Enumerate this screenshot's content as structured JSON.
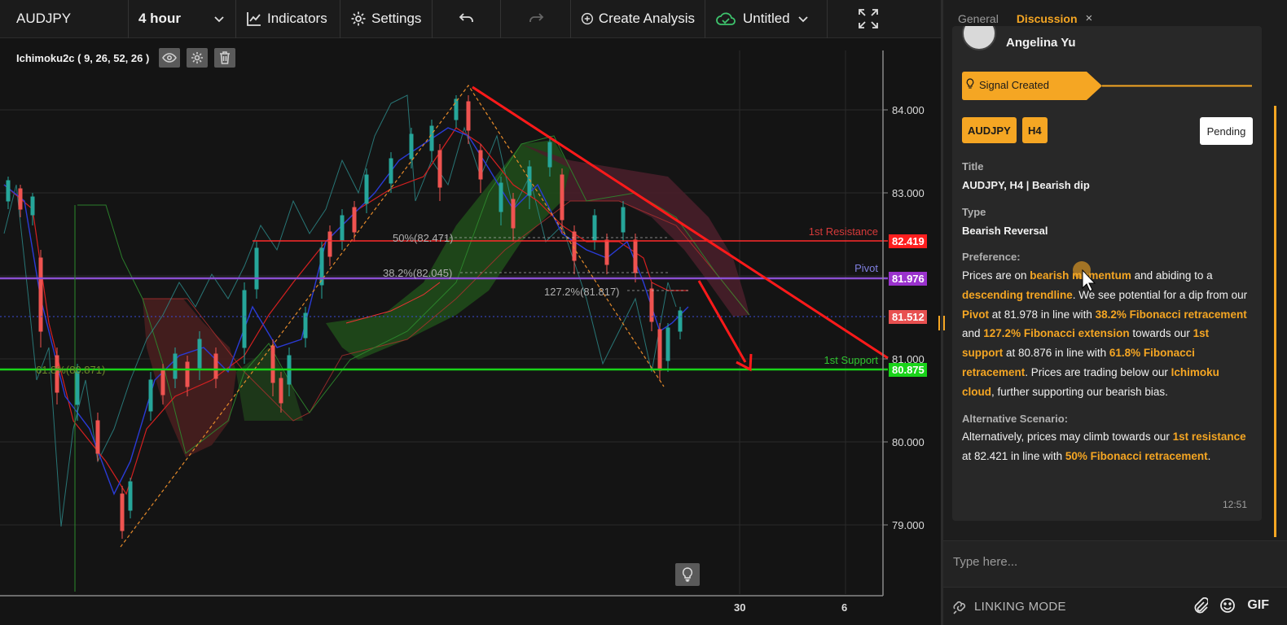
{
  "toolbar": {
    "symbol": "AUDJPY",
    "interval": "4 hour",
    "indicators_label": "Indicators",
    "settings_label": "Settings",
    "create_label": "Create Analysis",
    "layout_name": "Untitled"
  },
  "chart": {
    "indicator_label": "Ichimoku2c ( 9, 26, 52, 26 )",
    "price_axis": [
      "84.000",
      "83.000",
      "81.000",
      "80.000",
      "79.000"
    ],
    "time_axis": [
      "30",
      "6"
    ],
    "levels": {
      "resistance_label": "1st Resistance",
      "resistance_price": "82.419",
      "pivot_label": "Pivot",
      "pivot_price": "81.976",
      "current_price": "81.512",
      "support_label": "1st Support",
      "support_price": "80.875"
    },
    "fib_labels": {
      "fib50": "50%(82.471)",
      "fib382": "38.2%(82.045)",
      "fib1272": "127.2%(81.817)",
      "fib618": "61.8%(80.871)"
    },
    "colors": {
      "resistance": "#ff2b2b",
      "pivot": "#9a32cd",
      "support": "#19d319",
      "current": "#e85050",
      "accent": "#f5a623"
    }
  },
  "panel": {
    "tab_general": "General",
    "tab_discussion": "Discussion",
    "tab_close": "×",
    "author": "Angelina Yu",
    "signal_label": "Signal Created",
    "chip_symbol": "AUDJPY",
    "chip_timeframe": "H4",
    "status": "Pending",
    "title_label": "Title",
    "title_value": "AUDJPY, H4 | Bearish dip",
    "type_label": "Type",
    "type_value": "Bearish Reversal",
    "preference_label": "Preference:",
    "preference": {
      "t1": "Prices are on ",
      "h1": "bearish momentum",
      "t2": " and abiding to a ",
      "h2": "descending trendline",
      "t3": ". We see potential for a dip from our ",
      "h3": "Pivot",
      "t4": " at 81.978 in line with ",
      "h4": "38.2% Fibonacci retracement",
      "t5": " and ",
      "h5": "127.2% Fibonacci extension",
      "t6": " towards our ",
      "h6": "1st support",
      "t7": " at 80.876 in line with ",
      "h7": "61.8% Fibonacci retracement",
      "t8": ". Prices are trading below our ",
      "h8": "Ichimoku cloud",
      "t9": ", further supporting our bearish bias."
    },
    "alt_label": "Alternative Scenario:",
    "alternative": {
      "t1": "Alternatively, prices may climb towards our ",
      "h1": "1st resistance",
      "t2": " at 82.421 in line with ",
      "h2": "50% Fibonacci retracement",
      "t3": "."
    },
    "timestamp": "12:51",
    "input_placeholder": "Type here...",
    "linking_mode": "LINKING MODE",
    "gif_label": "GIF"
  }
}
